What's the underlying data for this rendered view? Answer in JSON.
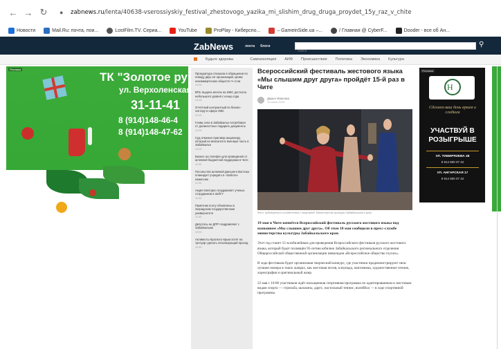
{
  "browser": {
    "url_domain": "zabnews.ru",
    "url_path": "/lenta/40638-vserossiyskiy_festival_zhestovogo_yazika_mi_slishim_drug_druga_proydet_15y_raz_v_chite",
    "bookmarks": [
      {
        "label": "Новости",
        "color": "#1e6fd9"
      },
      {
        "label": "Mail.Ru: почта, пои...",
        "color": "#2c6fbf"
      },
      {
        "label": "LostFilm.TV. Сериа...",
        "color": "#555555"
      },
      {
        "label": "YouTube",
        "color": "#e62117"
      },
      {
        "label": "ProPlay - Киберспо...",
        "color": "#9a8a2a"
      },
      {
        "label": "– GameinSide.ua –...",
        "color": "#d23b32"
      },
      {
        "label": "/ Главная @ CyberF...",
        "color": "#444444"
      },
      {
        "label": "Dooder - все об Ан...",
        "color": "#222222"
      }
    ]
  },
  "site": {
    "logo": "ZabNews",
    "top_nav": [
      "лента",
      "блоги"
    ],
    "search_placeholder": "поиск",
    "sub_nav": [
      "Будьте здоровы",
      "Самоизоляция",
      "АИФ",
      "Происшествия",
      "Политика",
      "Экономика",
      "Культура"
    ]
  },
  "left_banner": {
    "ad_tag": "Реклама",
    "title": "ТК \"Золотое ру",
    "street": "ул. Верхоленская,",
    "short_phone": "31-11-41",
    "phone_1": "8 (914)148-46-4",
    "phone_2": "8 (914)148-47-62"
  },
  "news_list": [
    {
      "title": "Прокуратура отказала в обращении по поводу двух её организаций, кроме некоммерческих обществ тч ссли",
      "date": "13:00"
    },
    {
      "title": "ВТБ: выдача ипотек на ИЖС достигла небольшого уровня с конца года",
      "date": "13:00"
    },
    {
      "title": "Отчётный контрактный по бизнес-сектору в сфере ОВС",
      "date": "12:00"
    },
    {
      "title": "Глава села в Забайкалье потребовал от должностных подарить документы",
      "date": "12:00"
    },
    {
      "title": "Суд отменил приговор акционеру, который не вписался в военную часть в Забайкалье",
      "date": "12:00"
    },
    {
      "title": "Бизнес на телефон для проведения от активной бюджетной поддержки в Чите",
      "date": "11:30"
    },
    {
      "title": "Посольство активной Дальнего Востока планирует учредить в «Забота» комиссию",
      "date": "11:30"
    },
    {
      "title": "Акция повторно поздравляет ученых сотрудников в ЗабГУ",
      "date": "11:00"
    },
    {
      "title": "Памятник поэту обновлены в Заградском государственном университете",
      "date": "11:00"
    },
    {
      "title": "Депутаты не ДПР поздравляют с Забайкальем",
      "date": "10:30"
    },
    {
      "title": "Активисты Красного Крым хотят на тротуар сделать легализующий проход",
      "date": "10:30"
    }
  ],
  "article": {
    "title": "Всероссийский фестиваль жестового языка «Мы слышим друг друга» пройдёт 15-й раз в Чите",
    "author": "Дарья Иванова",
    "date": "19 июня 2020",
    "caption": "Фото: публикуется в соответствии с лицензией. Министерство культуры Забайкальского края",
    "lead": "19 мая в Чите начнётся Всероссийский фестиваль русского жестового языка под названием «Мы слышим друг друга». Об этом 18 мая сообщили в пресс-службе министерства культуры Забайкальского края.",
    "paragraph_1": "Этот год станет 15-м юбилейным для проведения Всероссийского фестиваля русского жестового языка, который будет посвящён 95-летию юбилею Забайкальского регионального отделения Общероссийской общественной организации инвалидов «Всероссийское общество глухих».",
    "paragraph_2": "В ходе фестиваля будет организован творческий конкурс, где участники продемонстрируют свои лучшие номера в таких жанрах, как жестовая песня, клоунада, пантомима, художественное чтение, хореография и оригинальный жанр.",
    "paragraph_3": "22 мая с 10:00 участников ждёт насыщенная спортивная программа по адаптированным и жестовым видам спорта — стрельба, шахматы, дартс, настольный теннис, волейбол — в ходе спортивной программы."
  },
  "right_banner": {
    "ad_tag": "Реклама",
    "logo_letter": "Н",
    "slogan": "Сделаем ваш день ярким и сладким",
    "cta_1": "УЧАСТВУЙ В",
    "cta_2": "РОЗЫГРЫШЕ",
    "address_1": "УЛ. ТИМИРЯЗЕВА 48",
    "phone_1": "8 914 800 07 42",
    "address_2": "УЛ. АНГАРСКАЯ 17",
    "phone_2": "8 914 800 07 42"
  }
}
